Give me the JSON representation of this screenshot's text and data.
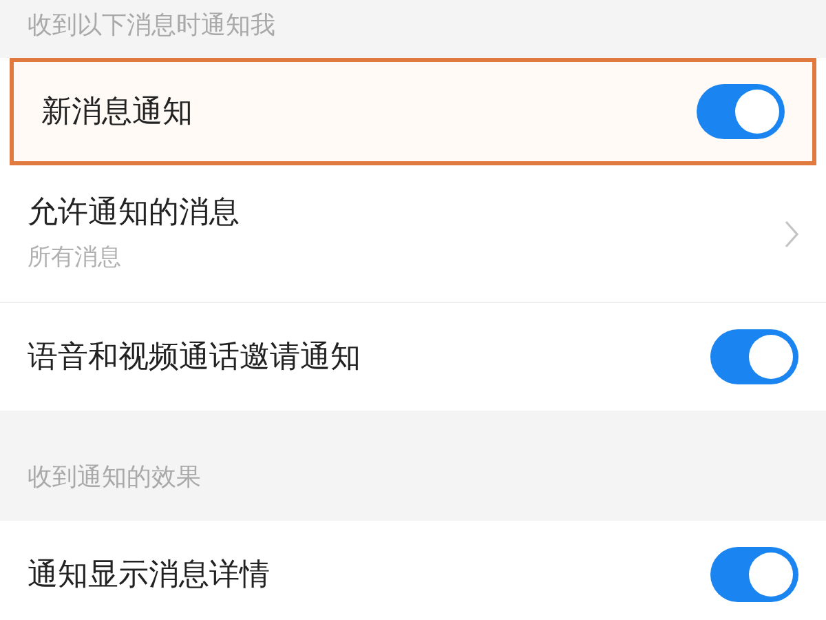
{
  "sections": [
    {
      "header": "收到以下消息时通知我",
      "items": [
        {
          "kind": "toggle",
          "label": "新消息通知",
          "on": true,
          "highlighted": true
        },
        {
          "kind": "link",
          "label": "允许通知的消息",
          "subtitle": "所有消息",
          "highlighted": false
        },
        {
          "kind": "toggle",
          "label": "语音和视频通话邀请通知",
          "on": true,
          "highlighted": false
        }
      ]
    },
    {
      "header": "收到通知的效果",
      "items": [
        {
          "kind": "toggle",
          "label": "通知显示消息详情",
          "on": true,
          "highlighted": false
        }
      ]
    }
  ]
}
